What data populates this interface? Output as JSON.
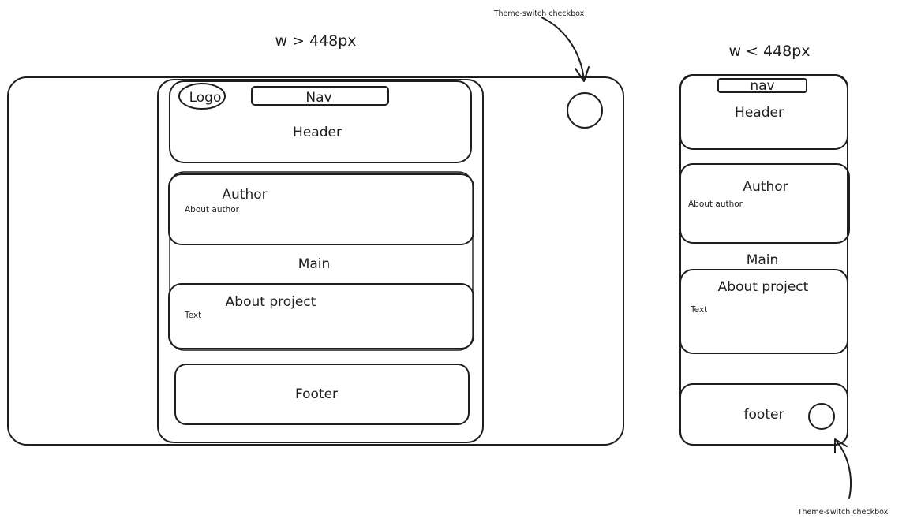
{
  "desktop": {
    "width_condition": "w > 448px",
    "logo": "Logo",
    "nav": "Nav",
    "header": "Header",
    "author_title": "Author",
    "author_text": "About author",
    "main": "Main",
    "project_title": "About project",
    "project_text": "Text",
    "footer": "Footer",
    "theme_switch_note": "Theme-switch checkbox"
  },
  "mobile": {
    "width_condition": "w < 448px",
    "nav": "nav",
    "header": "Header",
    "author_title": "Author",
    "author_text": "About author",
    "main": "Main",
    "project_title": "About project",
    "project_text": "Text",
    "footer": "footer",
    "theme_switch_note": "Theme-switch checkbox"
  }
}
